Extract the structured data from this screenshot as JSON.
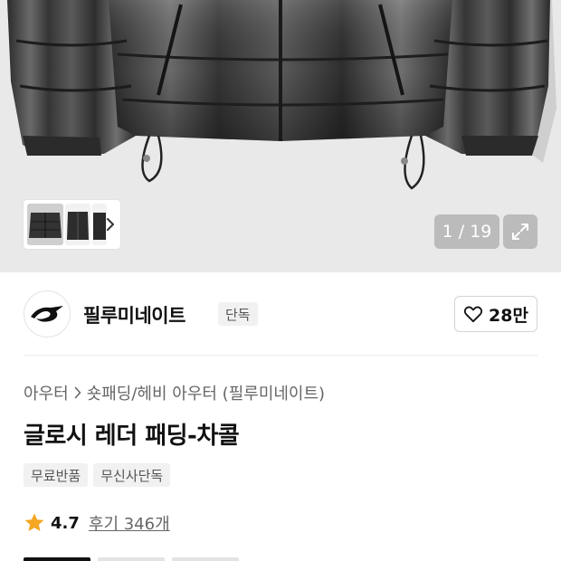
{
  "gallery": {
    "page_current": "1",
    "page_total": "19",
    "page_label": "1 / 19"
  },
  "brand": {
    "name": "필루미네이트",
    "badge": "단독",
    "like_count": "28만"
  },
  "product": {
    "breadcrumb": [
      "아우터",
      "숏패딩/헤비 아우터 (필루미네이트)"
    ],
    "title": "글로시 레더 패딩-차콜",
    "tags": [
      "무료반품",
      "무신사단독"
    ],
    "rating": "4.7",
    "reviews": "후기 346개"
  },
  "colors": {
    "star": "#f5a623",
    "hero_bg": "#e9e9e9",
    "jacket": "#3a3a3a"
  },
  "icons": {
    "thumb_next": "chevron-right-icon",
    "expand": "expand-icon",
    "like": "heart-outline-icon",
    "breadcrumb_sep": "chevron-right-icon",
    "rating": "star-icon"
  }
}
